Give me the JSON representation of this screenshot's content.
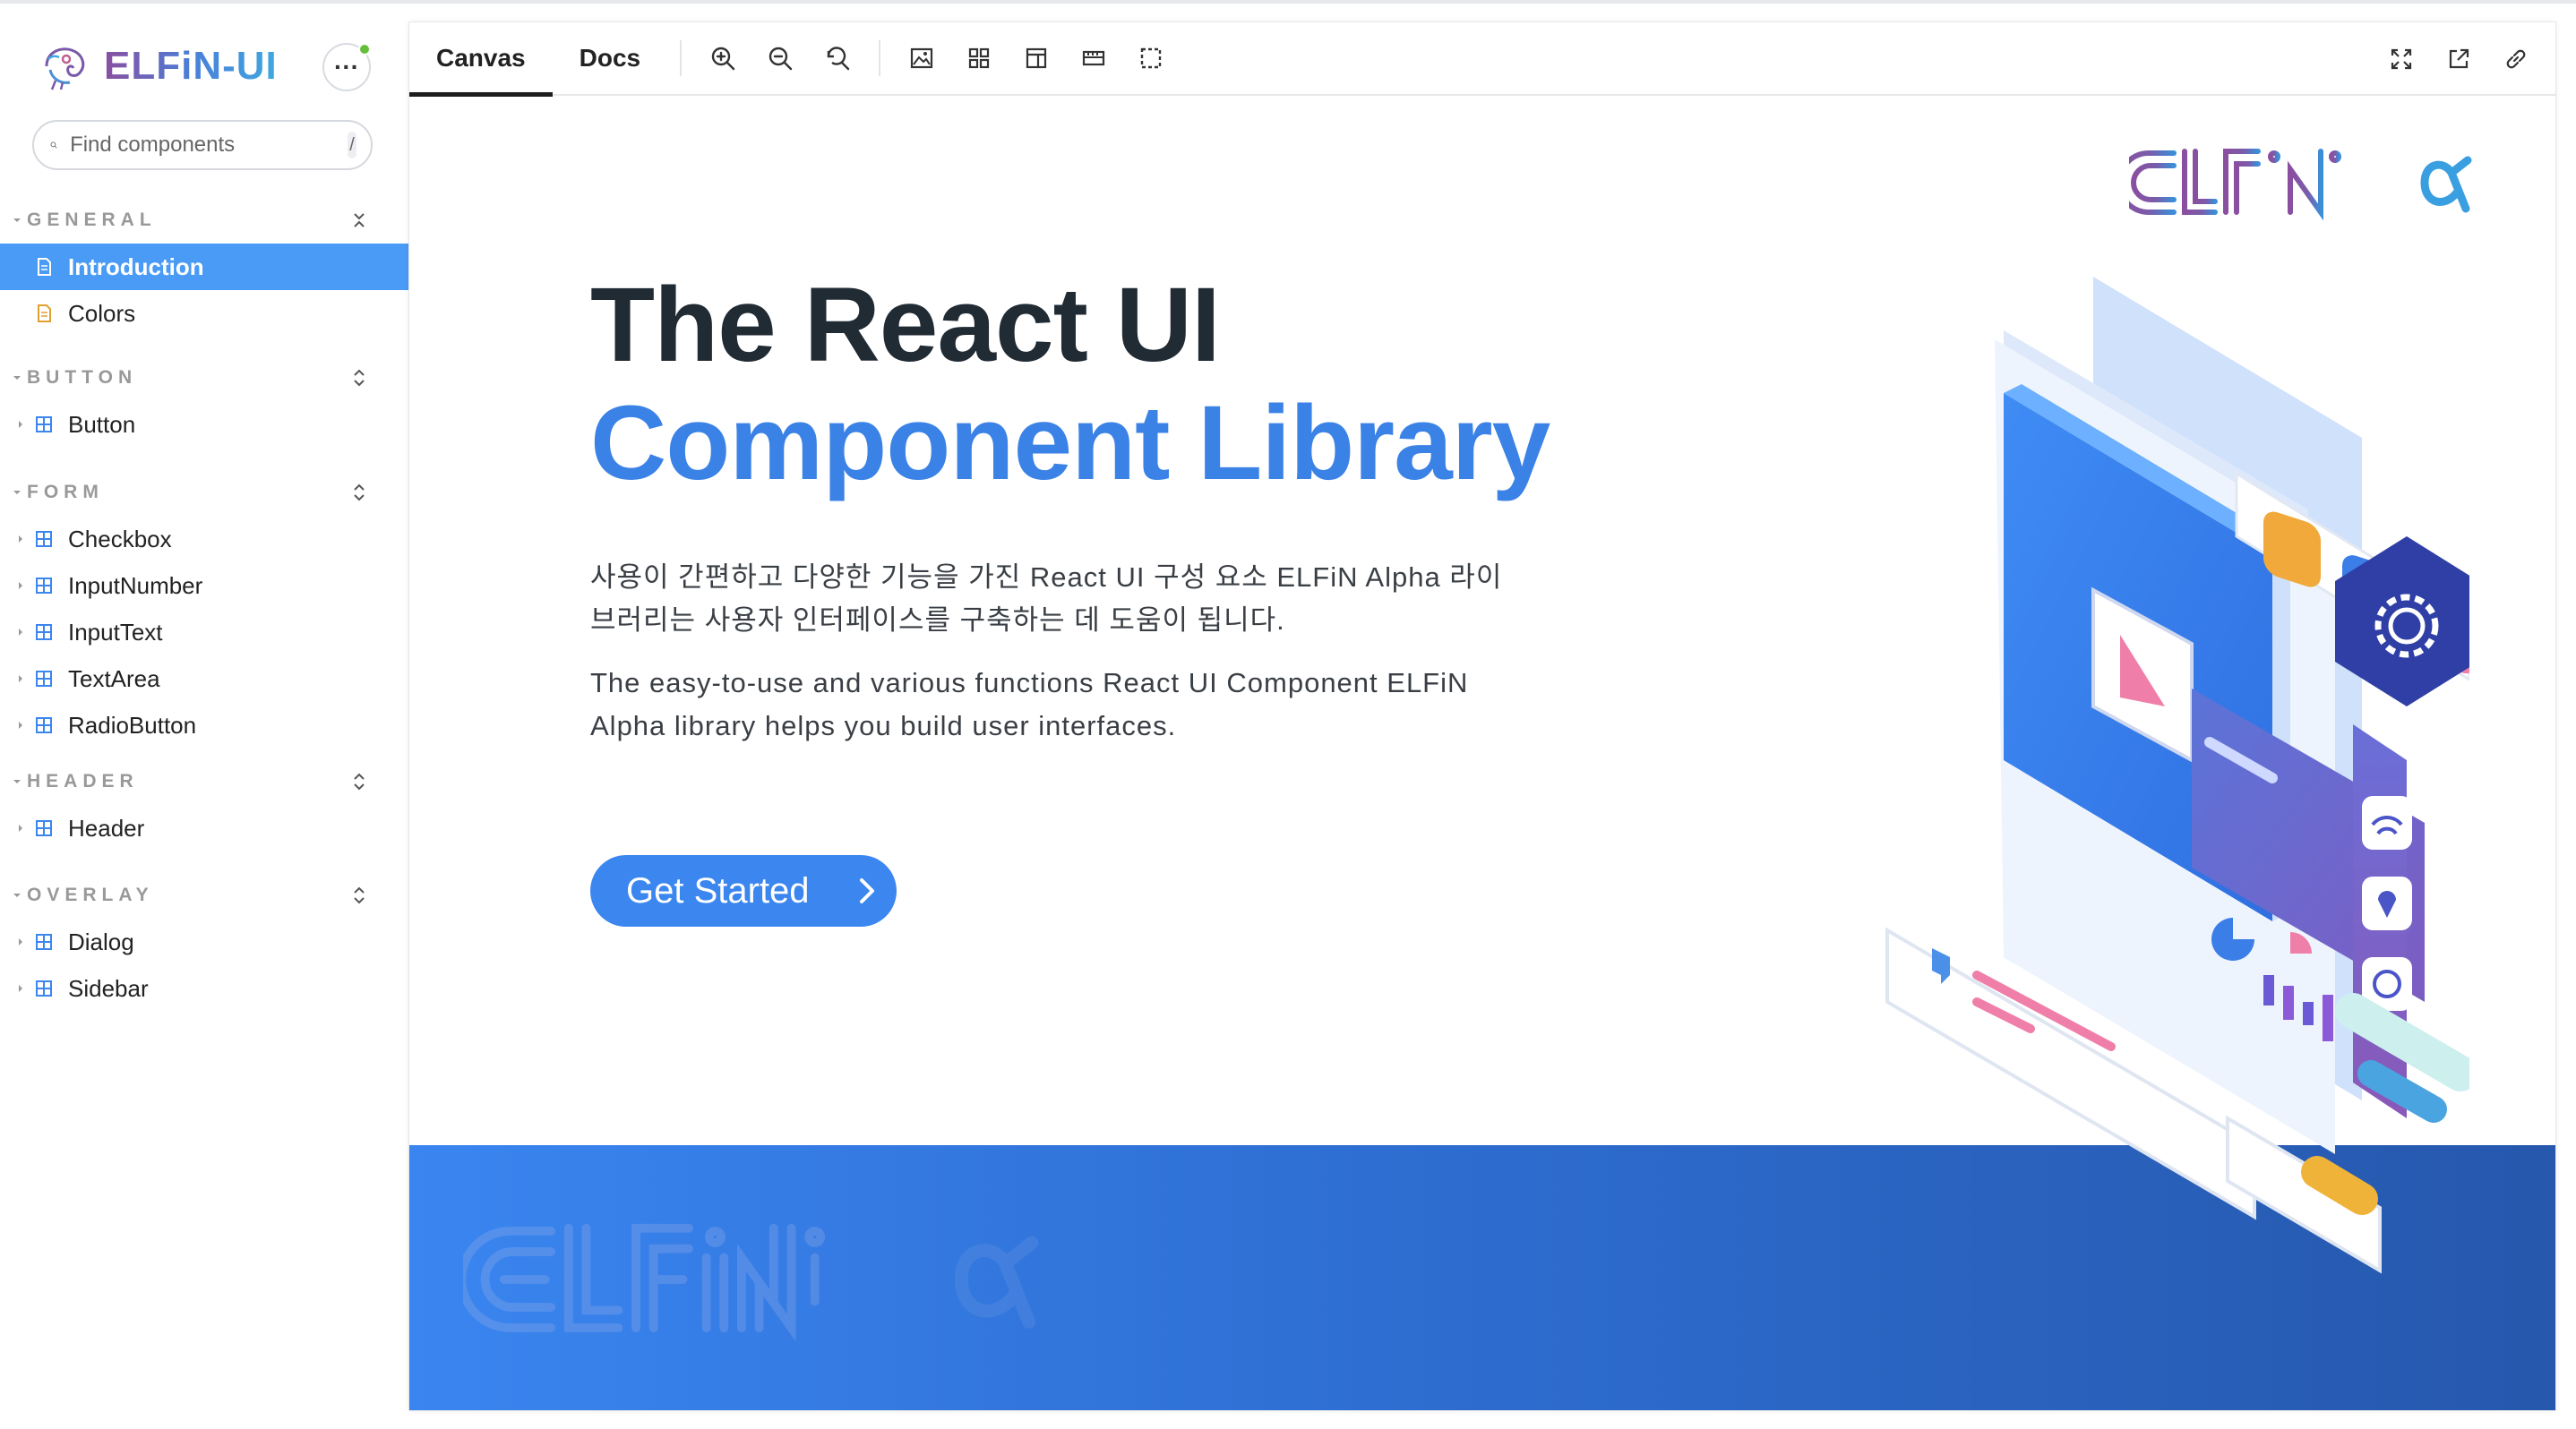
{
  "sidebar": {
    "brand": "ELFiN-UI",
    "search_placeholder": "Find components",
    "search_shortcut": "/",
    "sections": [
      {
        "title": "GENERAL",
        "items": [
          {
            "label": "Introduction"
          },
          {
            "label": "Colors"
          }
        ]
      },
      {
        "title": "BUTTON",
        "items": [
          {
            "label": "Button"
          }
        ]
      },
      {
        "title": "FORM",
        "items": [
          {
            "label": "Checkbox"
          },
          {
            "label": "InputNumber"
          },
          {
            "label": "InputText"
          },
          {
            "label": "TextArea"
          },
          {
            "label": "RadioButton"
          }
        ]
      },
      {
        "title": "HEADER",
        "items": [
          {
            "label": "Header"
          }
        ]
      },
      {
        "title": "OVERLAY",
        "items": [
          {
            "label": "Dialog"
          },
          {
            "label": "Sidebar"
          }
        ]
      }
    ]
  },
  "toolbar": {
    "tabs": [
      "Canvas",
      "Docs"
    ],
    "active_tab": "Canvas",
    "tools": [
      "zoom-in-icon",
      "zoom-out-icon",
      "zoom-reset-icon",
      "image-background-icon",
      "grid-icon",
      "viewport-icon",
      "measure-icon",
      "outline-icon"
    ],
    "right_tools": [
      "fullscreen-icon",
      "open-new-tab-icon",
      "copy-link-icon"
    ]
  },
  "hero": {
    "title_line1": "The React UI",
    "title_line2": "Component Library",
    "desc_ko": "사용이 간편하고 다양한 기능을 가진 React UI 구성 요소 ELFiN Alpha 라이브러리는 사용자 인터페이스를 구축하는 데 도움이 됩니다.",
    "desc_en": "The easy-to-use and various functions React UI Component ELFiN Alpha library helps you build user interfaces.",
    "cta_label": "Get Started"
  },
  "colors": {
    "accent": "#3b86ef",
    "active_nav": "#4a9bf5",
    "title_dark": "#212b34",
    "title_blue": "#3b82e6",
    "status_online": "#66bf3c"
  }
}
